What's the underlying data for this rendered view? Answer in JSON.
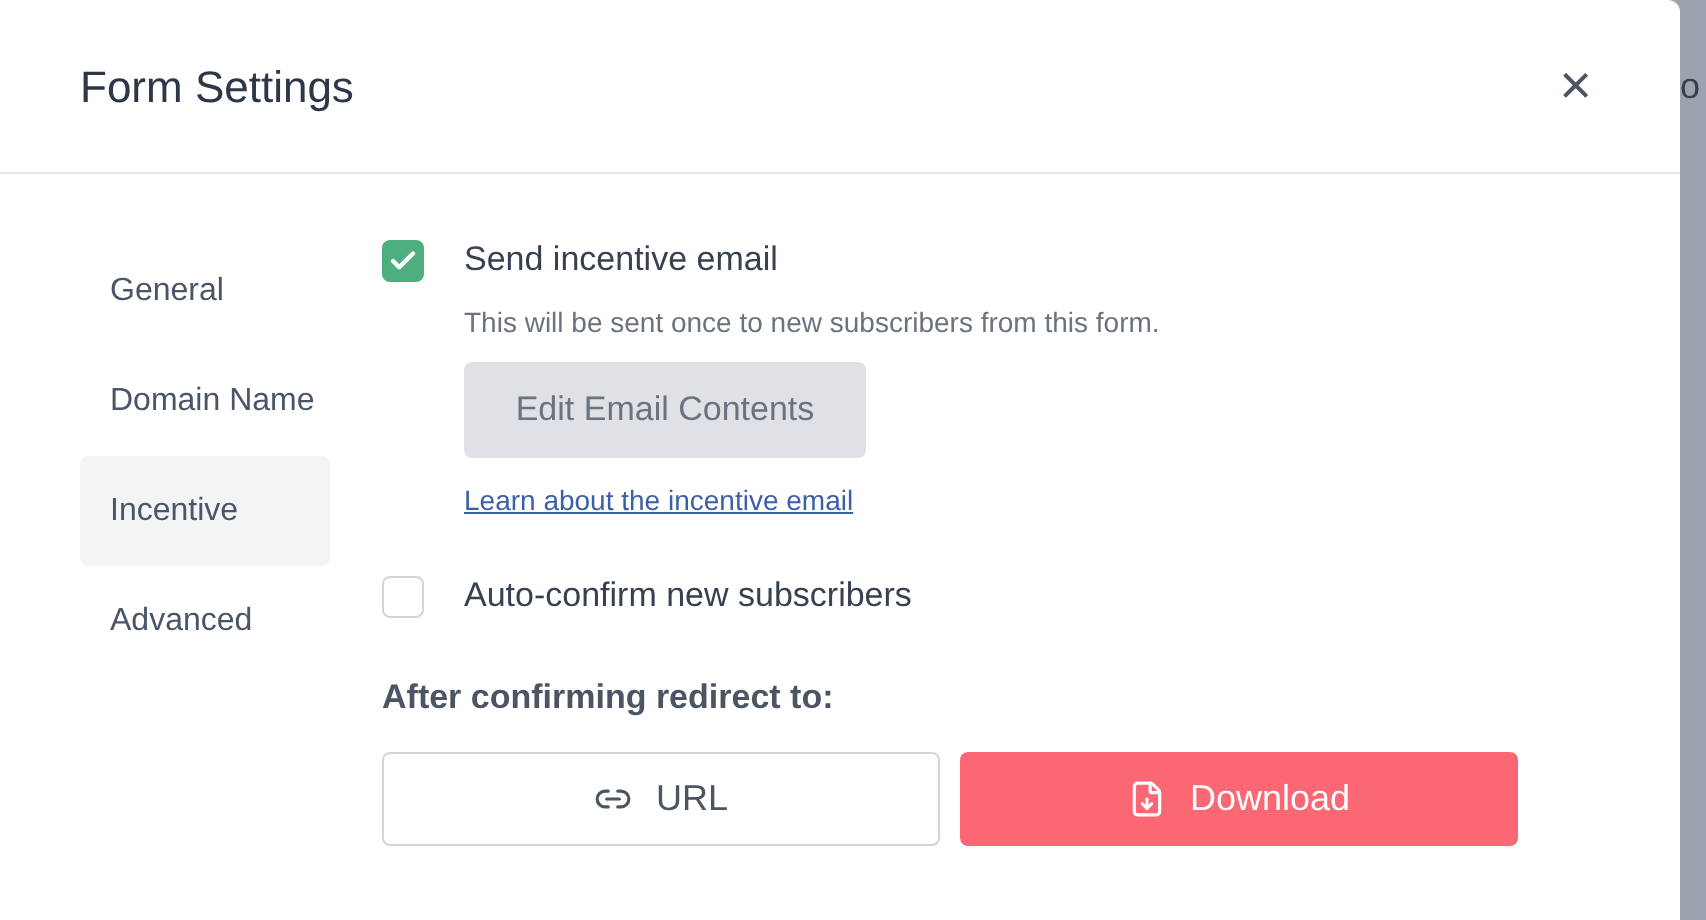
{
  "background_text": "o",
  "dialog": {
    "title": "Form Settings",
    "close": "×"
  },
  "sidebar": {
    "items": [
      {
        "label": "General",
        "selected": false
      },
      {
        "label": "Domain Name",
        "selected": false
      },
      {
        "label": "Incentive",
        "selected": true
      },
      {
        "label": "Advanced",
        "selected": false
      }
    ]
  },
  "incentive": {
    "label": "Send incentive email",
    "checked": true,
    "hint": "This will be sent once to new subscribers from this form.",
    "edit_button": "Edit Email Contents",
    "link": "Learn about the incentive email"
  },
  "auto_confirm": {
    "label": "Auto-confirm new subscribers",
    "checked": false
  },
  "redirect": {
    "label": "After confirming redirect to:",
    "options": [
      {
        "kind": "url",
        "label": "URL",
        "selected": false
      },
      {
        "kind": "download",
        "label": "Download",
        "selected": true
      }
    ]
  }
}
